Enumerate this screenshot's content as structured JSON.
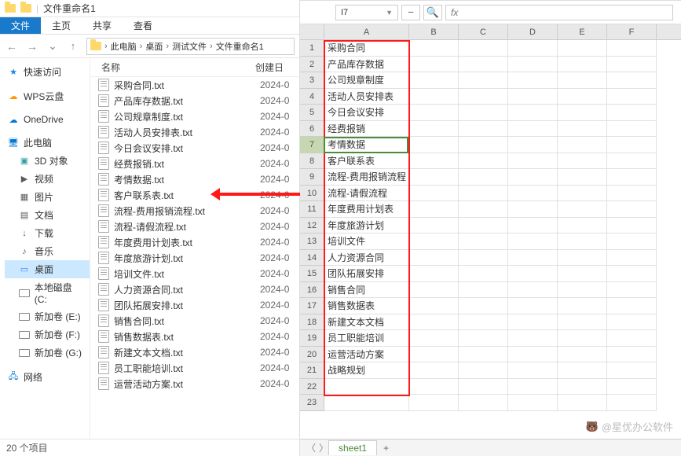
{
  "titlebar": {
    "title": "文件重命名1"
  },
  "ribbon": {
    "file": "文件",
    "home": "主页",
    "share": "共享",
    "view": "查看"
  },
  "address": {
    "parts": [
      "此电脑",
      "桌面",
      "测试文件",
      "文件重命名1"
    ]
  },
  "sidebar": {
    "quick": "快速访问",
    "wps": "WPS云盘",
    "onedrive": "OneDrive",
    "thispc": "此电脑",
    "sub": [
      "3D 对象",
      "视频",
      "图片",
      "文档",
      "下载",
      "音乐",
      "桌面",
      "本地磁盘 (C:",
      "新加卷 (E:)",
      "新加卷 (F:)",
      "新加卷 (G:)"
    ],
    "network": "网络"
  },
  "filelist": {
    "col_name": "名称",
    "col_date": "创建日",
    "date": "2024-0",
    "files": [
      "采购合同.txt",
      "产品库存数据.txt",
      "公司规章制度.txt",
      "活动人员安排表.txt",
      "今日会议安排.txt",
      "经费报销.txt",
      "考情数据.txt",
      "客户联系表.txt",
      "流程-费用报销流程.txt",
      "流程-请假流程.txt",
      "年度费用计划表.txt",
      "年度旅游计划.txt",
      "培训文件.txt",
      "人力资源合同.txt",
      "团队拓展安排.txt",
      "销售合同.txt",
      "销售数据表.txt",
      "新建文本文档.txt",
      "员工职能培训.txt",
      "运营活动方案.txt"
    ]
  },
  "statusbar": {
    "count": "20 个项目"
  },
  "excel": {
    "namebox": "I7",
    "fx": "fx",
    "cols": [
      "A",
      "B",
      "C",
      "D",
      "E",
      "F"
    ],
    "rows": 23,
    "dataA": [
      "采购合同",
      "产品库存数据",
      "公司规章制度",
      "活动人员安排表",
      "今日会议安排",
      "经费报销",
      "考情数据",
      "客户联系表",
      "流程-费用报销流程",
      "流程-请假流程",
      "年度费用计划表",
      "年度旅游计划",
      "培训文件",
      "人力资源合同",
      "团队拓展安排",
      "销售合同",
      "销售数据表",
      "新建文本文档",
      "员工职能培训",
      "运营活动方案",
      "战略规划"
    ],
    "sheet_tab": "sheet1"
  },
  "watermark": "@星优办公软件"
}
